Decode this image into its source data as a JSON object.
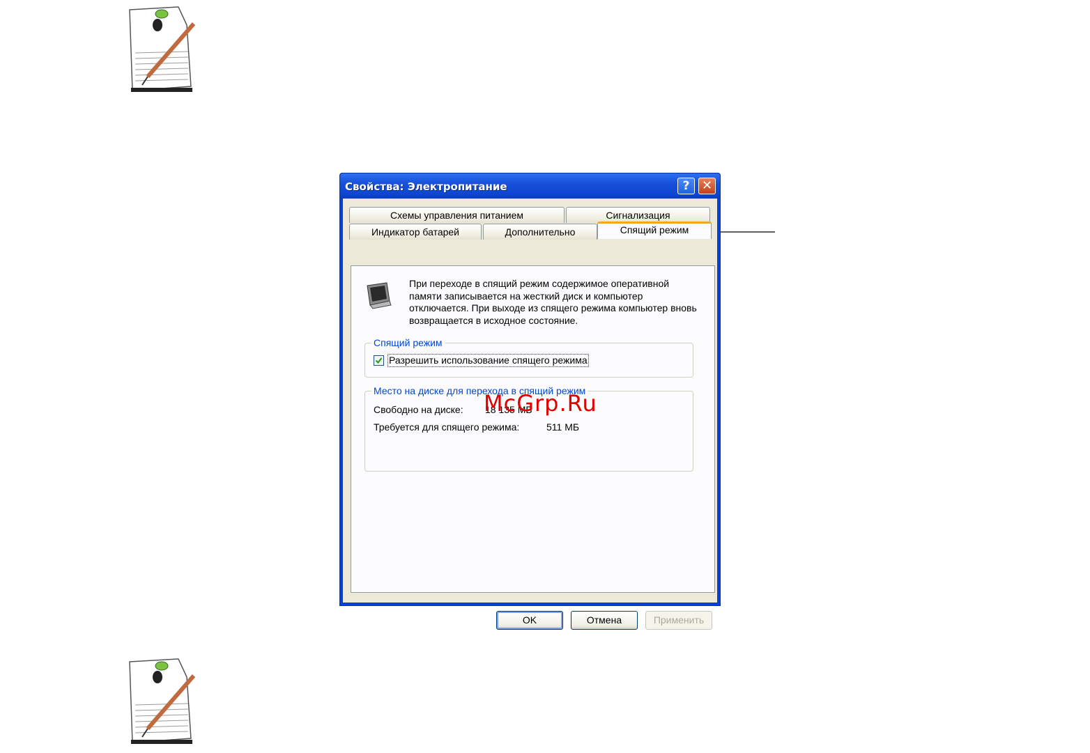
{
  "dialog": {
    "title": "Свойства: Электропитание",
    "help_button": "?",
    "close_button": "✕"
  },
  "tabs": {
    "power_schemes": "Схемы управления питанием",
    "alarms": "Сигнализация",
    "battery_meter": "Индикатор батарей",
    "advanced": "Дополнительно",
    "hibernate": "Спящий режим",
    "active": "hibernate"
  },
  "hibernate_tab": {
    "description": "При переходе в спящий режим содержимое оперативной памяти записывается на жесткий диск и компьютер отключается. При выходе из спящего режима компьютер вновь возвращается в исходное состояние.",
    "group_hibernate": {
      "title": "Спящий режим",
      "checkbox_label": "Разрешить использование спящего режима",
      "checked": true
    },
    "group_disk_space": {
      "title": "Место на диске для перехода в спящий режим",
      "free_label": "Свободно на диске:",
      "free_value": "18 135 МБ",
      "required_label": "Требуется для спящего режима:",
      "required_value": "511 МБ"
    }
  },
  "buttons": {
    "ok": "OK",
    "cancel": "Отмена",
    "apply": "Применить"
  },
  "watermark": "McGrp.Ru",
  "colors": {
    "titlebar": "#0d45d1",
    "active_tab_accent": "#f5a522",
    "group_title": "#0046d5",
    "watermark": "#e00000"
  }
}
